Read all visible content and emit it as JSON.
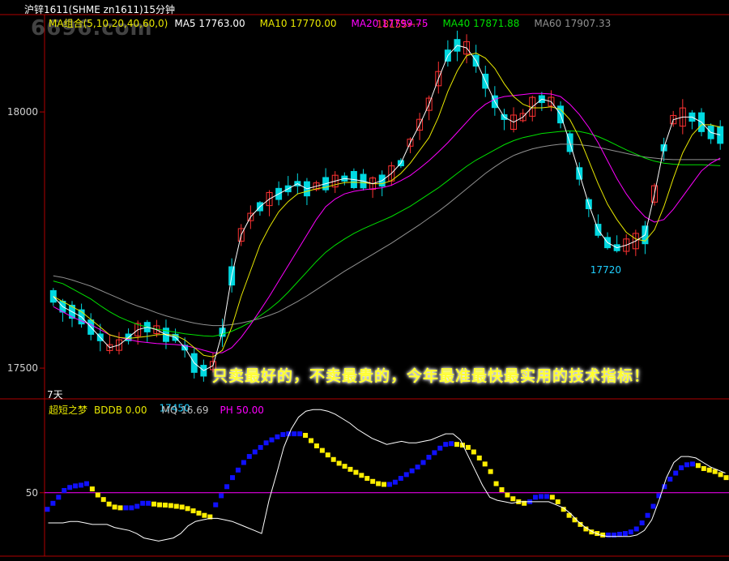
{
  "window": {
    "title": "沪锌1611(SHME zn1611)15分钟"
  },
  "watermark": "6696.com",
  "ma_header": [
    {
      "label": "MA组合(5,10,20,40,60,0)",
      "color": "#e8e800"
    },
    {
      "label": "MA5 17763.00",
      "color": "#ffffff"
    },
    {
      "label": "MA10 17770.00",
      "color": "#e8e800"
    },
    {
      "label": "MA20 17799.75",
      "color": "#ff00ff"
    },
    {
      "label": "MA40 17871.88",
      "color": "#00e000"
    },
    {
      "label": "MA60 17907.33",
      "color": "#909090"
    }
  ],
  "sub_header": [
    {
      "label": "超短之梦",
      "color": "#e8e800"
    },
    {
      "label": "BDDB  0.00",
      "color": "#e8e800"
    },
    {
      "label": "MQ  16.69",
      "color": "#c0c0c0"
    },
    {
      "label": "PH  50.00",
      "color": "#ff00ff"
    }
  ],
  "period_label": "7天",
  "annotation": "只卖最好的，不卖最贵的，今年最准最快最实用的技术指标！",
  "colors": {
    "up": "#ff3232",
    "down": "#00d8e0",
    "ma5": "#ffffff",
    "ma10": "#e8e800",
    "ma20": "#ff00ff",
    "ma40": "#00e000",
    "ma60": "#909090",
    "axis": "#b00000",
    "mq_up": "#1010ff",
    "mq_down": "#ffee00",
    "mq_line": "#ffffff",
    "ph_line": "#ff00ff"
  },
  "chart_data": [
    {
      "type": "candlestick",
      "title": "沪锌1611(SHME zn1611)15分钟",
      "y_ticks": [
        17500,
        18000
      ],
      "ylim": [
        17440,
        18190
      ],
      "annotations": [
        {
          "label": "18155",
          "value": 18155,
          "kind": "high"
        },
        {
          "label": "17450",
          "value": 17450,
          "kind": "low"
        },
        {
          "label": "17720",
          "value": 17720,
          "kind": "low"
        }
      ],
      "candles": [],
      "ma5": [
        17640,
        17620,
        17610,
        17600,
        17580,
        17560,
        17540,
        17545,
        17560,
        17575,
        17580,
        17575,
        17565,
        17560,
        17540,
        17510,
        17495,
        17505,
        17570,
        17680,
        17760,
        17795,
        17815,
        17830,
        17840,
        17850,
        17860,
        17850,
        17855,
        17860,
        17865,
        17870,
        17868,
        17865,
        17860,
        17866,
        17880,
        17900,
        17940,
        17975,
        18015,
        18065,
        18110,
        18130,
        18125,
        18100,
        18060,
        18020,
        17990,
        17980,
        17990,
        18010,
        18025,
        18020,
        17995,
        17940,
        17880,
        17820,
        17770,
        17745,
        17735,
        17740,
        17748,
        17760,
        17840,
        17930,
        17985,
        17990,
        17990,
        17980,
        17960,
        17955
      ],
      "ma10": [
        17640,
        17630,
        17620,
        17610,
        17595,
        17580,
        17565,
        17560,
        17558,
        17560,
        17562,
        17565,
        17566,
        17564,
        17555,
        17540,
        17525,
        17522,
        17535,
        17580,
        17640,
        17690,
        17740,
        17775,
        17805,
        17825,
        17840,
        17845,
        17850,
        17853,
        17858,
        17862,
        17863,
        17862,
        17860,
        17860,
        17866,
        17880,
        17900,
        17925,
        17950,
        17990,
        18040,
        18080,
        18110,
        18115,
        18105,
        18085,
        18055,
        18030,
        18015,
        18008,
        18008,
        18010,
        18005,
        17985,
        17950,
        17905,
        17860,
        17820,
        17790,
        17765,
        17752,
        17748,
        17770,
        17815,
        17870,
        17920,
        17955,
        17975,
        17975,
        17970
      ],
      "ma20": [
        17620,
        17610,
        17600,
        17592,
        17585,
        17575,
        17565,
        17560,
        17556,
        17552,
        17550,
        17548,
        17547,
        17546,
        17544,
        17540,
        17535,
        17530,
        17530,
        17540,
        17560,
        17585,
        17612,
        17640,
        17670,
        17700,
        17730,
        17760,
        17790,
        17815,
        17830,
        17840,
        17845,
        17848,
        17850,
        17852,
        17857,
        17866,
        17876,
        17890,
        17905,
        17922,
        17940,
        17960,
        17980,
        18000,
        18015,
        18025,
        18030,
        18032,
        18034,
        18036,
        18036,
        18035,
        18030,
        18015,
        17995,
        17970,
        17940,
        17905,
        17870,
        17840,
        17815,
        17795,
        17785,
        17790,
        17810,
        17835,
        17860,
        17885,
        17900,
        17910
      ],
      "ma40": [
        17670,
        17665,
        17655,
        17645,
        17635,
        17622,
        17610,
        17600,
        17592,
        17585,
        17580,
        17576,
        17573,
        17570,
        17567,
        17565,
        17563,
        17562,
        17566,
        17572,
        17580,
        17590,
        17602,
        17615,
        17630,
        17648,
        17668,
        17688,
        17708,
        17726,
        17740,
        17752,
        17763,
        17772,
        17780,
        17788,
        17796,
        17806,
        17816,
        17828,
        17840,
        17852,
        17866,
        17880,
        17894,
        17906,
        17916,
        17926,
        17936,
        17944,
        17950,
        17954,
        17958,
        17960,
        17962,
        17963,
        17962,
        17958,
        17952,
        17944,
        17935,
        17926,
        17918,
        17910,
        17904,
        17900,
        17898,
        17897,
        17897,
        17897,
        17896,
        17895
      ],
      "ma60": [
        17680,
        17677,
        17672,
        17666,
        17660,
        17652,
        17644,
        17636,
        17628,
        17621,
        17615,
        17608,
        17602,
        17597,
        17592,
        17588,
        17585,
        17583,
        17583,
        17585,
        17588,
        17592,
        17597,
        17603,
        17610,
        17620,
        17630,
        17641,
        17653,
        17665,
        17677,
        17689,
        17700,
        17711,
        17722,
        17733,
        17744,
        17756,
        17768,
        17780,
        17793,
        17806,
        17820,
        17835,
        17850,
        17865,
        17880,
        17893,
        17905,
        17915,
        17922,
        17928,
        17932,
        17935,
        17937,
        17937,
        17936,
        17934,
        17931,
        17927,
        17923,
        17919,
        17915,
        17912,
        17910,
        17908,
        17907,
        17907,
        17907,
        17907,
        17907,
        17907
      ]
    },
    {
      "type": "indicator",
      "title": "超短之梦",
      "y_ticks": [
        50
      ],
      "ylim": [
        8,
        110
      ],
      "ph": 50,
      "mq": [
        39.0,
        43.0,
        47.0,
        51.5,
        53.5,
        54.5,
        55.0,
        56.0,
        52.5,
        48.5,
        45.5,
        42.5,
        40.5,
        40.0,
        40.0,
        40.0,
        41.0,
        43.0,
        43.0,
        42.5,
        42.0,
        41.8,
        41.5,
        41.0,
        40.5,
        39.5,
        38.0,
        36.5,
        35.0,
        34.0,
        42.0,
        48.0,
        54.0,
        60.0,
        65.0,
        70.0,
        74.0,
        77.0,
        80.0,
        83.0,
        85.0,
        87.0,
        88.5,
        89.0,
        89.0,
        89.0,
        88.0,
        84.5,
        81.0,
        78.0,
        75.0,
        72.0,
        69.5,
        67.5,
        65.5,
        63.5,
        61.5,
        59.5,
        57.5,
        56.0,
        55.5,
        55.5,
        57.0,
        59.5,
        62.0,
        64.5,
        67.0,
        70.0,
        73.5,
        76.5,
        79.5,
        82.0,
        82.5,
        82.0,
        81.5,
        80.0,
        77.0,
        73.0,
        69.0,
        64.0,
        56.0,
        52.0,
        48.5,
        46.0,
        44.0,
        43.0,
        44.0,
        47.0,
        47.5,
        47.5,
        47.0,
        44.0,
        39.0,
        35.0,
        32.0,
        29.0,
        26.0,
        24.0,
        23.0,
        22.0,
        22.0,
        22.0,
        22.5,
        23.0,
        24.0,
        26.0,
        30.0,
        35.0,
        41.0,
        48.0,
        54.0,
        59.0,
        63.0,
        66.5,
        68.5,
        69.0,
        68.0,
        66.0,
        65.0,
        64.0,
        62.0,
        60.0
      ],
      "mq_line": [
        30,
        30,
        30,
        31,
        31,
        30,
        29,
        29,
        29,
        27,
        26,
        25,
        23,
        20,
        19,
        18,
        19,
        20,
        23,
        28,
        31,
        32,
        33,
        33,
        32,
        31,
        29,
        27,
        25,
        23,
        45,
        62,
        80,
        92,
        100,
        104,
        105,
        105,
        104,
        102,
        99,
        96,
        92,
        89,
        86,
        84,
        82,
        83,
        84,
        83,
        83,
        84,
        85,
        87,
        89,
        89,
        85,
        75,
        65,
        55,
        47,
        45,
        44,
        43,
        44,
        44,
        44,
        44,
        44,
        42,
        40,
        36,
        31,
        27,
        24,
        22,
        21,
        21,
        21,
        21,
        22,
        25,
        32,
        45,
        60,
        70,
        74,
        74,
        73,
        70,
        67,
        65,
        63
      ]
    }
  ]
}
